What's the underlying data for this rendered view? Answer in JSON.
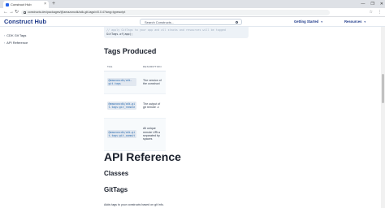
{
  "browser": {
    "tab_title": "Construct Hub",
    "new_tab": "+",
    "controls": [
      "—",
      "❐",
      "✕"
    ],
    "url": "constructs.dev/packages/@amazoncdk/cdk-git-tags/v/0.0.4?lang=typescript",
    "back": "←",
    "forward": "→",
    "reload": "↻",
    "icons": [
      "☆",
      "⋮"
    ]
  },
  "header": {
    "logo": "Construct Hub",
    "search_placeholder": "Search Constructs...",
    "getting_started": "Getting Started",
    "resources": "Resources"
  },
  "sidebar": {
    "items": [
      "CDK Git Tags",
      "API Reference"
    ]
  },
  "main": {
    "code_comment": "// apply GitTags to your app and all stacks and resources will be tagged",
    "code_line": "GitTags.of(app);",
    "tags_heading": "Tags Produced",
    "table_headers": [
      "TAG",
      "DESCRIPTION"
    ],
    "rows": [
      {
        "tag": "@amazoncdk/cdk-git-tags",
        "desc": "The version of the construct"
      },
      {
        "tag": "@amazoncdk/cdk-git-tags:git_remote",
        "desc": "The output of git remote -v"
      },
      {
        "tag": "@amazoncdk/cdk-git-tags:git_commit",
        "desc": "All unique remote URLs separated by spaces"
      }
    ],
    "row2_desc_code": "git remote --v",
    "row2_desc_prefix": "The output of",
    "api_heading": "API Reference",
    "classes_heading": "Classes",
    "gittags_heading": "GitTags",
    "gittags_desc": "Adds tags to your constructs based on git info."
  },
  "colors": {
    "brand": "#1e3a8a",
    "code_text": "#2b6cb0"
  }
}
